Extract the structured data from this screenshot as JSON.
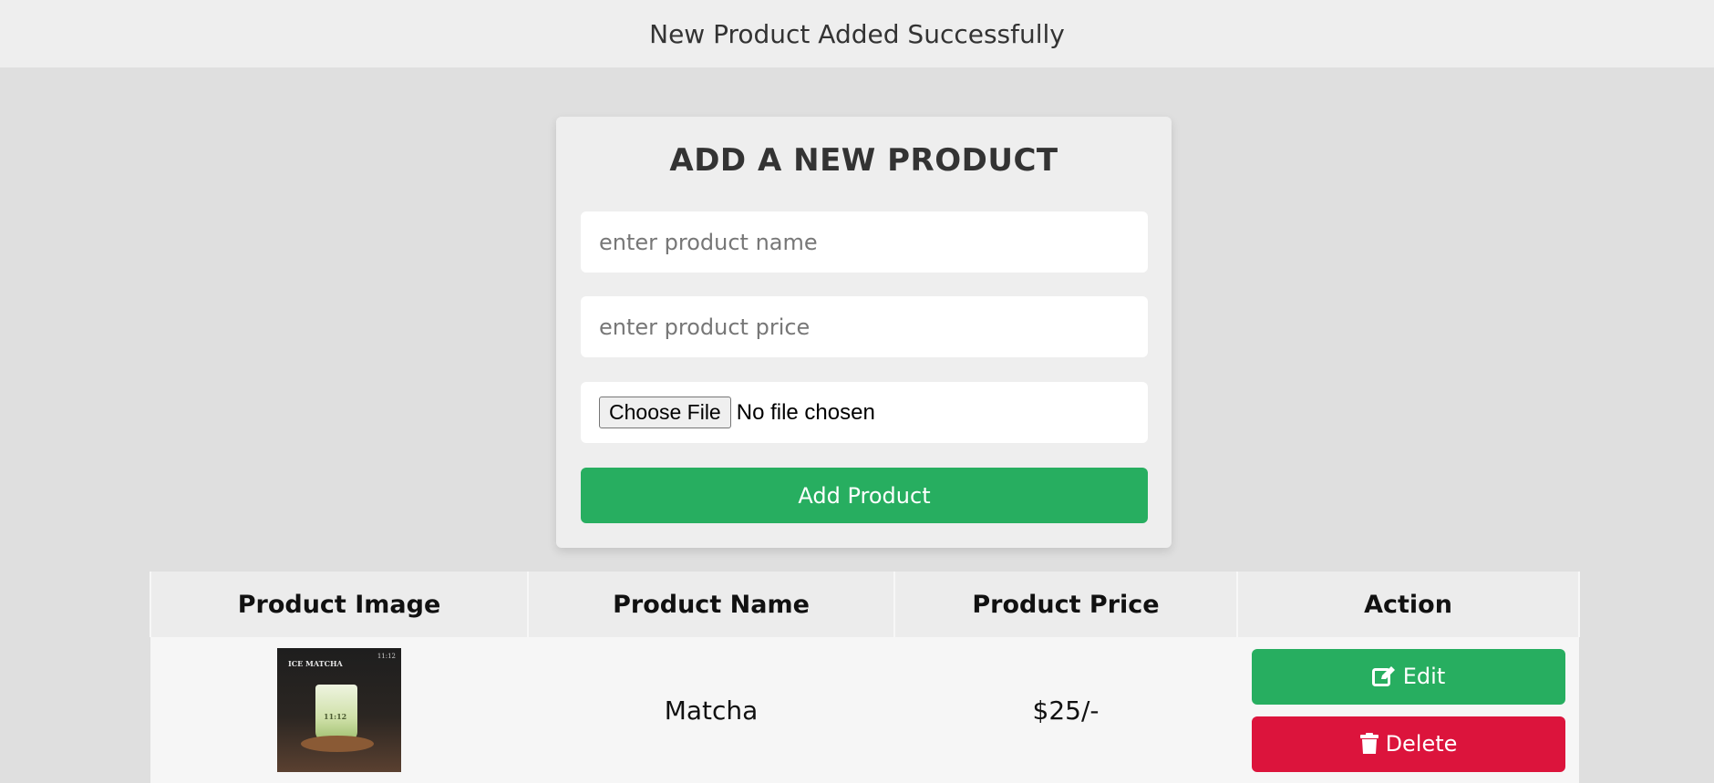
{
  "message": "New Product Added Successfully",
  "form": {
    "title": "ADD A NEW PRODUCT",
    "name_placeholder": "enter product name",
    "price_placeholder": "enter product price",
    "file_button": "Choose File",
    "file_status": "No file chosen",
    "submit_label": "Add Product"
  },
  "table": {
    "headers": [
      "Product Image",
      "Product Name",
      "Product Price",
      "Action"
    ],
    "rows": [
      {
        "image_caption": "ICE MATCHA",
        "image_corner": "11:12",
        "image_label": "11:12",
        "name": "Matcha",
        "price": "$25/-",
        "edit_label": "Edit",
        "delete_label": "Delete"
      }
    ]
  },
  "colors": {
    "success": "#27ae60",
    "danger": "#dc143c"
  },
  "icons": {
    "edit": "edit-icon",
    "delete": "trash-icon"
  }
}
